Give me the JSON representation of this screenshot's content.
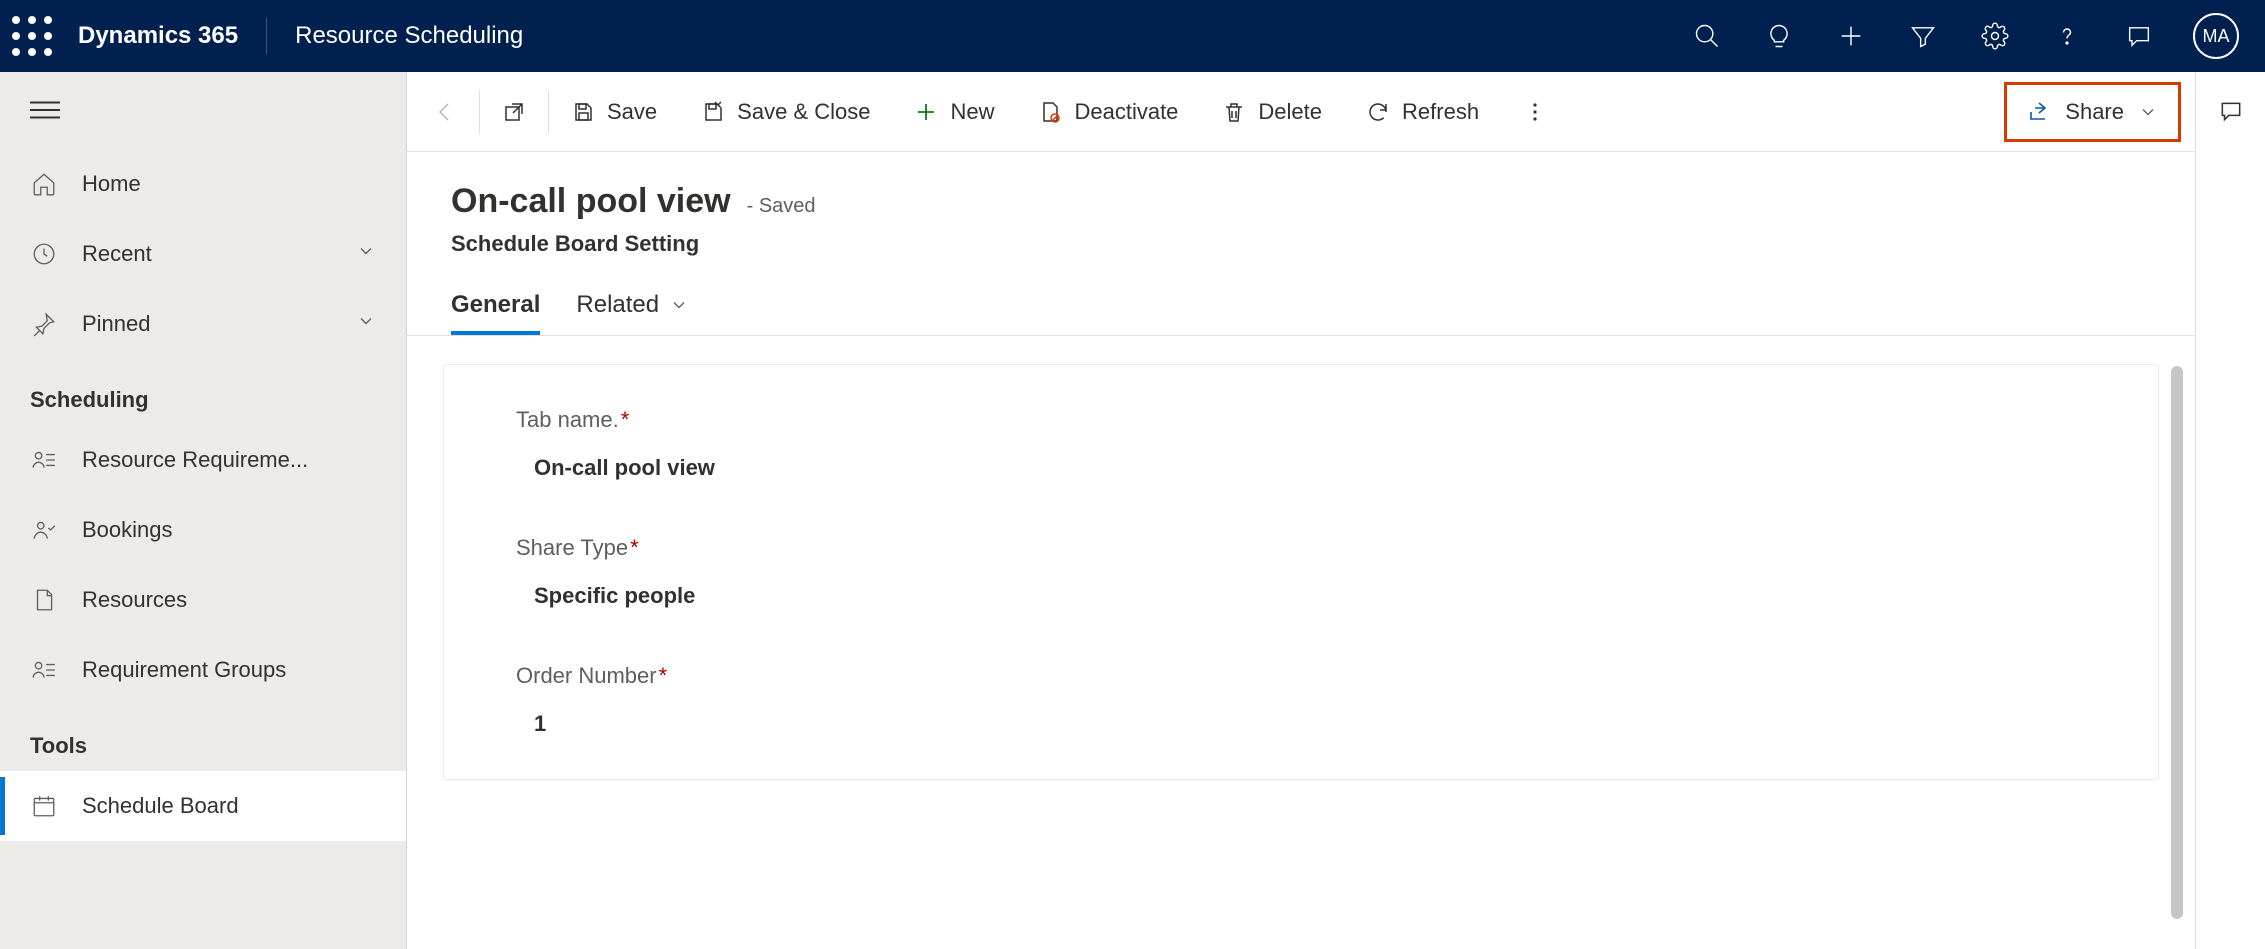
{
  "header": {
    "brand": "Dynamics 365",
    "module": "Resource Scheduling",
    "avatar_initials": "MA"
  },
  "sidebar": {
    "home": "Home",
    "recent": "Recent",
    "pinned": "Pinned",
    "group_scheduling": "Scheduling",
    "resource_requirements": "Resource Requireme...",
    "bookings": "Bookings",
    "resources": "Resources",
    "requirement_groups": "Requirement Groups",
    "group_tools": "Tools",
    "schedule_board": "Schedule Board"
  },
  "cmdbar": {
    "save": "Save",
    "save_close": "Save & Close",
    "new": "New",
    "deactivate": "Deactivate",
    "delete": "Delete",
    "refresh": "Refresh",
    "share": "Share"
  },
  "page": {
    "title": "On-call pool view",
    "saved_suffix": "- Saved",
    "entity": "Schedule Board Setting"
  },
  "tabs": {
    "general": "General",
    "related": "Related"
  },
  "form": {
    "tab_name_label": "Tab name.",
    "tab_name_value": "On-call pool view",
    "share_type_label": "Share Type",
    "share_type_value": "Specific people",
    "order_number_label": "Order Number",
    "order_number_value": "1"
  }
}
